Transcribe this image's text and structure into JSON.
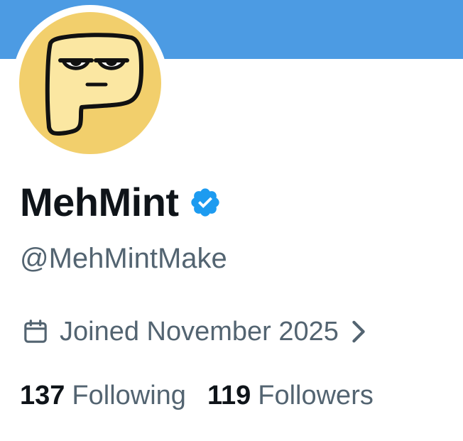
{
  "colors": {
    "banner": "#4c9be3",
    "avatar_background": "#f2cf6c",
    "verified_badge": "#1d9bf0",
    "primary_text": "#0f1419",
    "secondary_text": "#536471"
  },
  "profile": {
    "display_name": "MehMint",
    "verified": true,
    "handle": "@MehMintMake",
    "joined": "Joined November 2025"
  },
  "stats": {
    "following_count": "137",
    "following_label": "Following",
    "followers_count": "119",
    "followers_label": "Followers"
  },
  "icons": {
    "avatar": "p-character-avatar",
    "badge": "verified-badge-icon",
    "joined": "calendar-icon",
    "joined_more": "chevron-right-icon"
  }
}
